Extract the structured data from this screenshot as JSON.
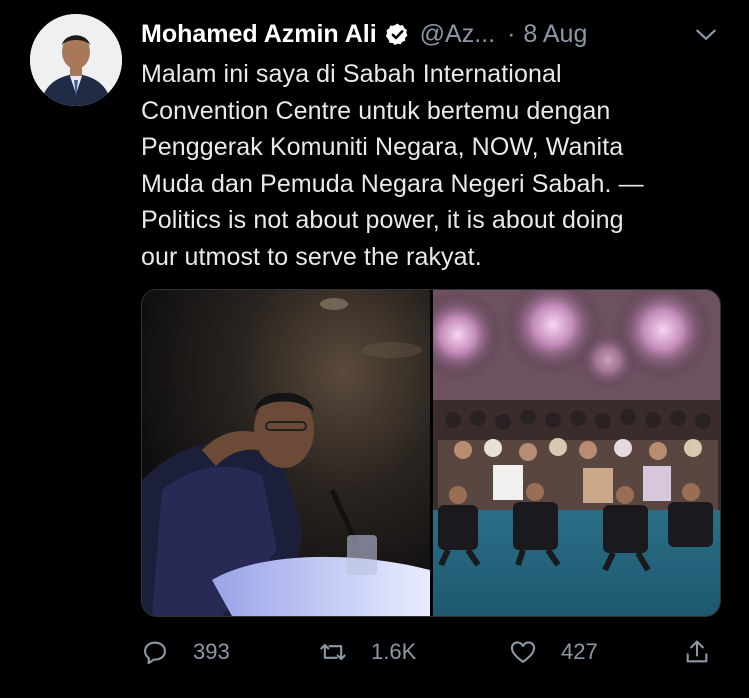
{
  "tweet": {
    "author_name": "Mohamed Azmin Ali",
    "handle": "@Az...",
    "separator": "·",
    "date": "8 Aug",
    "text": "Malam ini saya di Sabah International\nConvention Centre untuk bertemu dengan\nPenggerak Komuniti Negara, NOW, Wanita\nMuda dan Pemuda Negara Negeri Sabah.  —\nPolitics is not about power, it is about doing\nour utmost to serve the rakyat."
  },
  "actions": {
    "replies": "393",
    "retweets": "1.6K",
    "likes": "427"
  },
  "icons": {
    "verified": "verified-badge-icon",
    "more": "chevron-down-icon",
    "reply": "reply-icon",
    "retweet": "retweet-icon",
    "like": "heart-icon",
    "share": "share-icon"
  },
  "colors": {
    "background": "#000000",
    "text": "#e7e9ea",
    "secondary": "#8b98a5",
    "verified": "#ffffff"
  }
}
